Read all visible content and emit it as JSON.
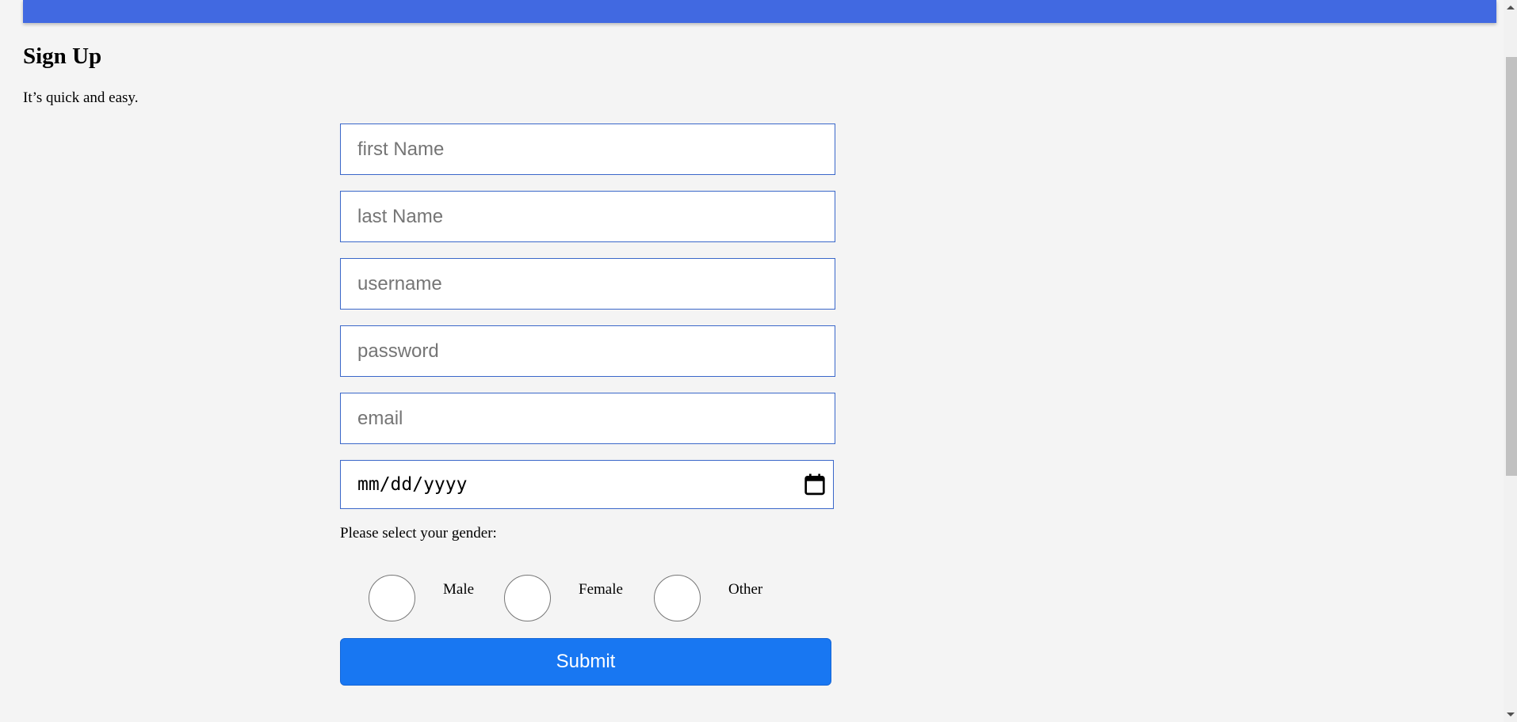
{
  "header": {
    "color": "#4169e1"
  },
  "page": {
    "title": "Sign Up",
    "subtitle": "It’s quick and easy."
  },
  "form": {
    "fields": [
      {
        "name": "first-name",
        "placeholder": "first Name",
        "value": ""
      },
      {
        "name": "last-name",
        "placeholder": "last Name",
        "value": ""
      },
      {
        "name": "username",
        "placeholder": "username",
        "value": ""
      },
      {
        "name": "password",
        "placeholder": "password",
        "value": ""
      },
      {
        "name": "email",
        "placeholder": "email",
        "value": ""
      }
    ],
    "date": {
      "placeholder": "mm/dd/yyyy",
      "icon": "calendar-icon"
    },
    "gender_prompt": "Please select your gender:",
    "gender_options": [
      {
        "label": "Male",
        "selected": false
      },
      {
        "label": "Female",
        "selected": false
      },
      {
        "label": "Other",
        "selected": false
      }
    ],
    "submit_label": "Submit",
    "submit_color": "#1877f2"
  }
}
